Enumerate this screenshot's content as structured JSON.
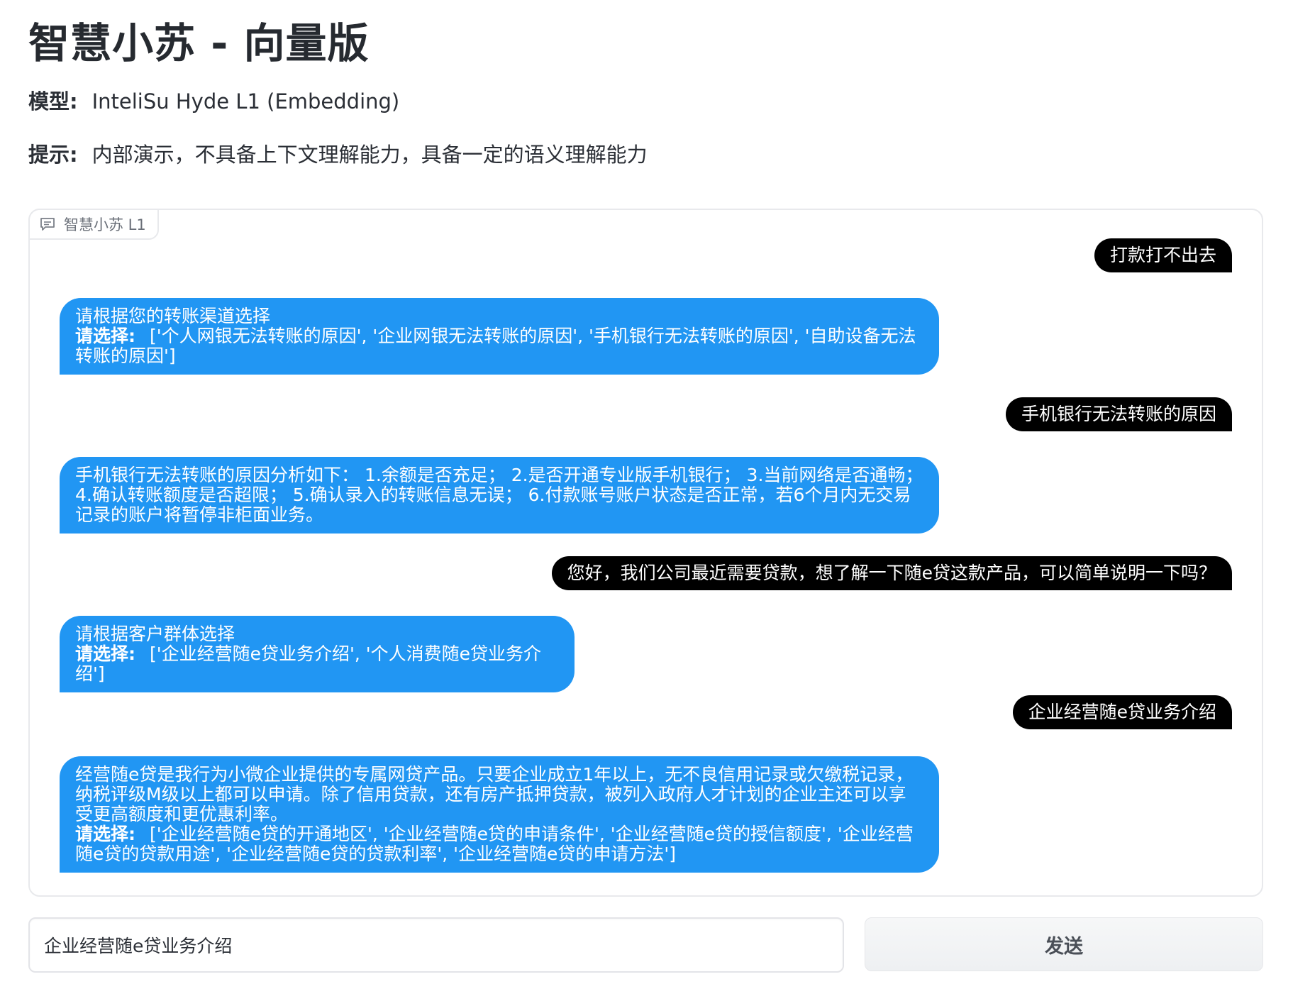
{
  "header": {
    "title": "智慧小苏 - 向量版",
    "model_key": "模型:",
    "model_value": "InteliSu Hyde L1 (Embedding)",
    "hint_key": "提示:",
    "hint_value": "内部演示，不具备上下文理解能力，具备一定的语义理解能力"
  },
  "chat": {
    "label": "智慧小苏 L1",
    "label_icon": "chat-bubble-icon",
    "messages": [
      {
        "role": "user",
        "text": "打款打不出去"
      },
      {
        "role": "bot",
        "line1": "请根据您的转账渠道选择",
        "choose_label": "请选择:",
        "options": "['个人网银无法转账的原因', '企业网银无法转账的原因', '手机银行无法转账的原因', '自助设备无法转账的原因']"
      },
      {
        "role": "user",
        "text": "手机银行无法转账的原因"
      },
      {
        "role": "bot",
        "text": "手机银行无法转账的原因分析如下： 1.余额是否充足； 2.是否开通专业版手机银行； 3.当前网络是否通畅； 4.确认转账额度是否超限； 5.确认录入的转账信息无误； 6.付款账号账户状态是否正常，若6个月内无交易记录的账户将暂停非柜面业务。"
      },
      {
        "role": "user",
        "text": "您好，我们公司最近需要贷款，想了解一下随e贷这款产品，可以简单说明一下吗？"
      },
      {
        "role": "bot",
        "line1": "请根据客户群体选择",
        "choose_label": "请选择:",
        "options": "['企业经营随e贷业务介绍', '个人消费随e贷业务介绍']"
      },
      {
        "role": "user",
        "text": "企业经营随e贷业务介绍"
      },
      {
        "role": "bot",
        "line1": "经营随e贷是我行为小微企业提供的专属网贷产品。只要企业成立1年以上，无不良信用记录或欠缴税记录，纳税评级M级以上都可以申请。除了信用贷款，还有房产抵押贷款，被列入政府人才计划的企业主还可以享受更高额度和更优惠利率。",
        "choose_label": "请选择:",
        "options": "['企业经营随e贷的开通地区', '企业经营随e贷的申请条件', '企业经营随e贷的授信额度', '企业经营随e贷的贷款用途', '企业经营随e贷的贷款利率', '企业经营随e贷的申请方法']"
      }
    ]
  },
  "composer": {
    "input_value": "企业经营随e贷业务介绍",
    "send_label": "发送"
  },
  "colors": {
    "bot_bubble": "#2196f3",
    "user_bubble": "#000000"
  }
}
